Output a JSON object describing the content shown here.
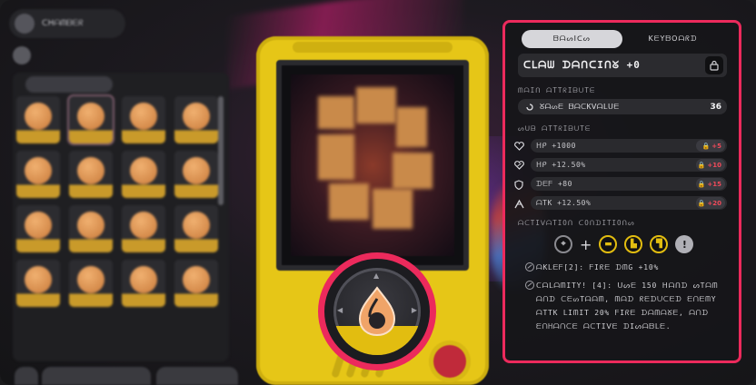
{
  "header": {
    "title": "ᑕᕼᗩᗰᗷᗴᖇ"
  },
  "panel": {
    "tabs": [
      {
        "label": "ᗷᗩᔕIᑕᔕ"
      },
      {
        "label": "KᗴYᗷOᗩᖇᗪ"
      }
    ],
    "title": "ᑕᒪᗩᗯ ᗪᗩᑎᑕIᑎᘜ +0",
    "main_attr_label": "ᗰᗩIᑎ ᗩTTᖇIᗷᑌTᗴ",
    "main_attr": {
      "name": "ᘜᗩᔕᗴ ᗷᗩᑕKᐯᗩᒪᑌᗴ",
      "value": "36"
    },
    "sub_attr_label": "ᔕᑌᗷ ᗩTTᖇIᗷᑌTᗴ",
    "sub_attrs": [
      {
        "icon": "heart-icon",
        "text": "ᕼᑭ +1000",
        "unlock": "+5"
      },
      {
        "icon": "heart-percent-icon",
        "text": "ᕼᑭ +12.50%",
        "unlock": "+10"
      },
      {
        "icon": "shield-icon",
        "text": "ᗪᗴᖴ +80",
        "unlock": "+15"
      },
      {
        "icon": "sword-icon",
        "text": "ᗩTK +12.50%",
        "unlock": "+20"
      }
    ],
    "requirements_label": "ᗩᑕTIᐯᗩTIOᑎ ᑕOᑎᗪITIOᑎᔕ",
    "requirements": [
      {
        "icon": "crosshair-icon",
        "kind": "gray",
        "glyph": "⌖"
      },
      {
        "icon": "slot-1-icon",
        "kind": "gold",
        "glyph": "▬"
      },
      {
        "icon": "slot-2-icon",
        "kind": "gold",
        "glyph": "▙"
      },
      {
        "icon": "slot-3-icon",
        "kind": "gold",
        "glyph": "▜"
      },
      {
        "icon": "info-icon",
        "kind": "bang",
        "glyph": "!"
      }
    ],
    "traits": [
      {
        "text": "ᗩKᒪᗴᖴ[2]: ᖴIᖇᗴ ᗪᗰG +10%"
      },
      {
        "text": "ᑕᗩᒪᗩᗰITY! [4]: ᑌᔕᗴ 150 ᕼᗩᑎᗪ ᔕTᗩᗰ ᗩᑎᗪ ᑕᗴᔕTᗩᗩᗰ, ᗰᗩᗪ ᖇᗴᗪᑌᑕᗴᗪ ᗴᑎᗴᗰY ᗩTTK ᒪIᗰIT 20% ᖴIᖇᗴ ᗪᗩᗰᗩᘜᗴ, ᗩᑎᗪ ᗴᑎᕼᗩᑎᑕᗴ ᗩᑕTIᐯᗴ ᗪIᔕᗩᗷᒪᗴ."
      }
    ]
  },
  "colors": {
    "accent": "#ec2a5c",
    "gold": "#e2bd10",
    "panel_bg": "#161619",
    "warn_text": "#ef4a5a"
  }
}
